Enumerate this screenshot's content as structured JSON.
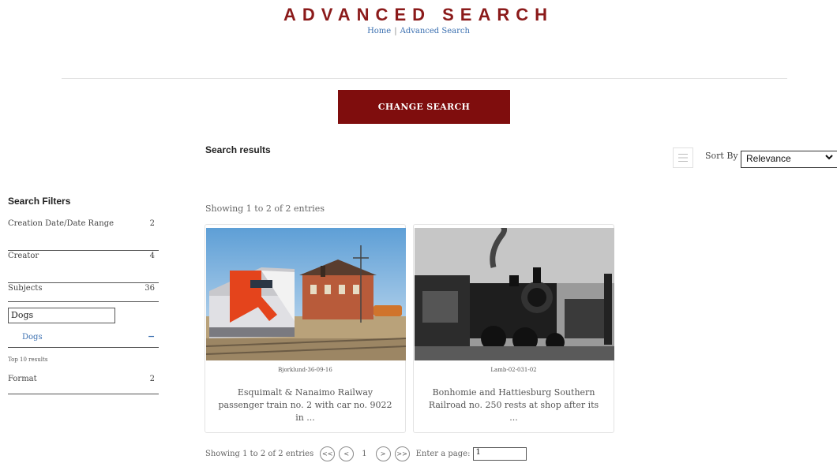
{
  "header": {
    "title": "ADVANCED SEARCH",
    "breadcrumb": {
      "home": "Home",
      "separator": "|",
      "current": "Advanced Search"
    }
  },
  "search": {
    "change_label": "CHANGE SEARCH"
  },
  "results": {
    "title": "Search results",
    "sort_label": "Sort By",
    "sort_value": "Relevance",
    "showing_text": "Showing 1 to 2 of 2 entries",
    "cards": [
      {
        "id": "Bjorklund-36-09-16",
        "title": "Esquimalt & Nanaimo Railway passenger train no. 2 with car no. 9022 in ..."
      },
      {
        "id": "Lamb-02-031-02",
        "title": "Bonhomie and Hattiesburg Southern Railroad no. 250 rests at shop after its ..."
      }
    ]
  },
  "filters": {
    "title": "Search Filters",
    "items": [
      {
        "label": "Creation Date/Date Range",
        "count": "2"
      },
      {
        "label": "Creator",
        "count": "4"
      },
      {
        "label": "Subjects",
        "count": "36"
      },
      {
        "label": "Format",
        "count": "2"
      }
    ],
    "subject_input_value": "Dogs",
    "subject_selected": "Dogs",
    "subject_remove": "−",
    "top_results_note": "Top 10 results"
  },
  "pagination": {
    "showing_text": "Showing 1 to 2 of 2 entries",
    "first": "<<",
    "prev": "<",
    "current_page": "1",
    "next": ">",
    "last": ">>",
    "enter_label": "Enter a page:",
    "page_input_value": "1"
  },
  "colors": {
    "brand": "#8b1a1a",
    "button": "#7f0d0d",
    "link": "#3a6fb0"
  }
}
